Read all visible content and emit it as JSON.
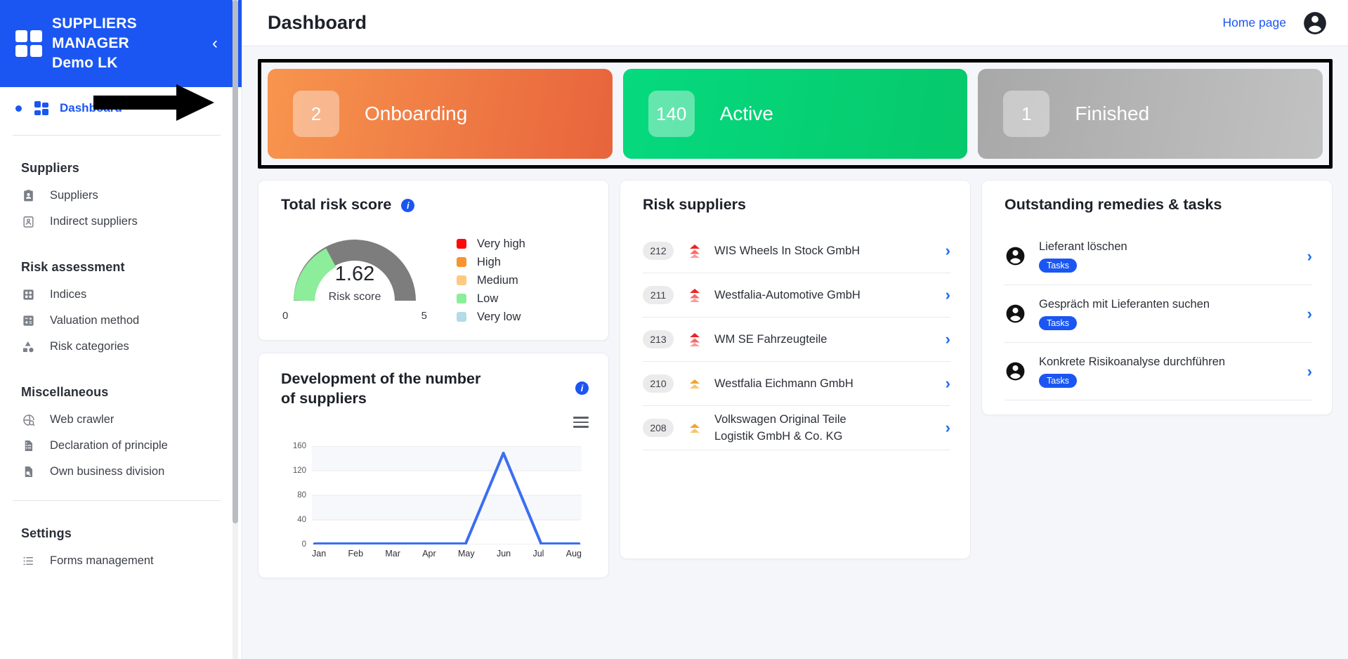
{
  "brand": {
    "line1": "SUPPLIERS",
    "line2": "MANAGER",
    "line3": "Demo LK",
    "collapse_icon": "chevron-left-icon",
    "color": "#1b56f2"
  },
  "sidebar": {
    "active_item": {
      "label": "Dashboard",
      "icon": "dashboard-grid-icon"
    },
    "sections": [
      {
        "title": "Suppliers",
        "items": [
          {
            "label": "Suppliers",
            "icon": "id-card-icon"
          },
          {
            "label": "Indirect suppliers",
            "icon": "id-card-outline-icon"
          }
        ]
      },
      {
        "title": "Risk assessment",
        "items": [
          {
            "label": "Indices",
            "icon": "grid-squares-icon"
          },
          {
            "label": "Valuation method",
            "icon": "calculator-icon"
          },
          {
            "label": "Risk categories",
            "icon": "shapes-icon"
          }
        ]
      },
      {
        "title": "Miscellaneous",
        "items": [
          {
            "label": "Web crawler",
            "icon": "web-crawler-search-icon"
          },
          {
            "label": "Declaration of principle",
            "icon": "document-list-icon"
          },
          {
            "label": "Own business division",
            "icon": "document-search-icon"
          }
        ]
      },
      {
        "title": "Settings",
        "items": [
          {
            "label": "Forms management",
            "icon": "list-icon"
          }
        ]
      }
    ]
  },
  "header": {
    "title": "Dashboard",
    "home_link": "Home page",
    "avatar_icon": "account-circle-icon"
  },
  "status_cards": [
    {
      "count": "2",
      "label": "Onboarding",
      "color": "#ee7a45"
    },
    {
      "count": "140",
      "label": "Active",
      "color": "#06d175"
    },
    {
      "count": "1",
      "label": "Finished",
      "color": "#b4b4b4"
    }
  ],
  "risk_score_card": {
    "title": "Total risk score",
    "info_icon": "info-icon",
    "value": "1.62",
    "value_label": "Risk score",
    "scale_min": "0",
    "scale_max": "5",
    "legend": [
      {
        "label": "Very high",
        "color": "#ff0a0a"
      },
      {
        "label": "High",
        "color": "#f79331"
      },
      {
        "label": "Medium",
        "color": "#ffc980"
      },
      {
        "label": "Low",
        "color": "#8ced9a"
      },
      {
        "label": "Very low",
        "color": "#b3dbe8"
      }
    ]
  },
  "chart_card": {
    "title": "Development of the number of suppliers",
    "info_icon": "info-icon",
    "menu_icon": "hamburger-menu-icon"
  },
  "chart_data": {
    "type": "line",
    "title": "Development of the number of suppliers",
    "xlabel": "",
    "ylabel": "",
    "categories": [
      "Jan",
      "Feb",
      "Mar",
      "Apr",
      "May",
      "Jun",
      "Jul",
      "Aug"
    ],
    "series": [
      {
        "name": "Suppliers",
        "values": [
          0,
          0,
          0,
          0,
          0,
          148,
          0,
          0
        ],
        "color": "#3b6ef0"
      }
    ],
    "yticks": [
      0,
      40,
      80,
      120,
      160
    ],
    "ylim": [
      0,
      160
    ],
    "grid": true,
    "legend": "none"
  },
  "risk_suppliers_card": {
    "title": "Risk suppliers",
    "rows": [
      {
        "id": "212",
        "name": "WIS Wheels In Stock GmbH",
        "risk_icon": "double-chevron-up-icon",
        "risk_color": "#ef2222",
        "chevron": "chevron-right-icon"
      },
      {
        "id": "211",
        "name": "Westfalia-Automotive GmbH",
        "risk_icon": "double-chevron-up-icon",
        "risk_color": "#ef2222",
        "chevron": "chevron-right-icon"
      },
      {
        "id": "213",
        "name": "WM SE Fahrzeugteile",
        "risk_icon": "double-chevron-up-icon",
        "risk_color": "#ef2222",
        "chevron": "chevron-right-icon"
      },
      {
        "id": "210",
        "name": "Westfalia Eichmann GmbH",
        "risk_icon": "double-chevron-up-icon",
        "risk_color": "#f0a52b",
        "chevron": "chevron-right-icon"
      },
      {
        "id": "208",
        "name": "Volkswagen Original Teile Logistik GmbH & Co. KG",
        "risk_icon": "double-chevron-up-icon",
        "risk_color": "#f0a52b",
        "chevron": "chevron-right-icon"
      }
    ]
  },
  "tasks_card": {
    "title": "Outstanding remedies & tasks",
    "rows": [
      {
        "name": "Lieferant löschen",
        "tag": "Tasks",
        "avatar_icon": "account-circle-icon",
        "chevron": "chevron-right-icon"
      },
      {
        "name": "Gespräch mit Lieferanten suchen",
        "tag": "Tasks",
        "avatar_icon": "account-circle-icon",
        "chevron": "chevron-right-icon"
      },
      {
        "name": "Konkrete Risikoanalyse durchführen",
        "tag": "Tasks",
        "avatar_icon": "account-circle-icon",
        "chevron": "chevron-right-icon"
      }
    ]
  }
}
